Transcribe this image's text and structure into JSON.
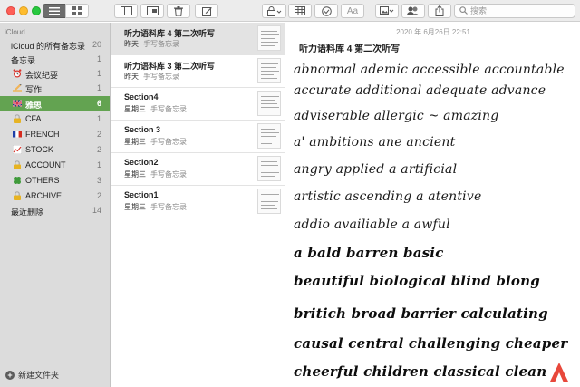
{
  "toolbar": {
    "search_placeholder": "搜索",
    "font_button_label": "Aa"
  },
  "sidebar": {
    "account": "iCloud",
    "items": [
      {
        "label": "iCloud 的所有备忘录",
        "count": "20",
        "icon": "none"
      },
      {
        "label": "备忘录",
        "count": "1",
        "icon": "none"
      },
      {
        "label": "会议纪要",
        "count": "1",
        "icon": "alarm-clock-icon"
      },
      {
        "label": "写作",
        "count": "1",
        "icon": "writing-hand-icon"
      },
      {
        "label": "雅思",
        "count": "6",
        "icon": "uk-flag-icon"
      },
      {
        "label": "CFA",
        "count": "1",
        "icon": "lock-icon"
      },
      {
        "label": "FRENCH",
        "count": "2",
        "icon": "french-flag-icon"
      },
      {
        "label": "STOCK",
        "count": "2",
        "icon": "chart-icon"
      },
      {
        "label": "ACCOUNT",
        "count": "1",
        "icon": "lock-icon"
      },
      {
        "label": "OTHERS",
        "count": "3",
        "icon": "clover-icon"
      },
      {
        "label": "ARCHIVE",
        "count": "2",
        "icon": "lock-icon"
      },
      {
        "label": "最近删除",
        "count": "14",
        "icon": "none"
      }
    ],
    "new_folder": "新建文件夹"
  },
  "notes": [
    {
      "title": "听力语料库 4 第二次听写",
      "date": "昨天",
      "folder": "手写备忘录"
    },
    {
      "title": "听力语料库 3 第二次听写",
      "date": "昨天",
      "folder": "手写备忘录"
    },
    {
      "title": "Section4",
      "date": "星期三",
      "folder": "手写备忘录"
    },
    {
      "title": "Section 3",
      "date": "星期三",
      "folder": "手写备忘录"
    },
    {
      "title": "Section2",
      "date": "星期三",
      "folder": "手写备忘录"
    },
    {
      "title": "Section1",
      "date": "星期三",
      "folder": "手写备忘录"
    }
  ],
  "editor": {
    "date": "2020 年 6月26日 22:51",
    "title": "听力语料库 4 第二次听写",
    "lines": [
      "abnormal   ademic   accessible  accountable",
      "accurate  additional  adequate  advance",
      "adviserable  allergic   ~   amazing",
      "a'       ambitions   ane   ancient",
      "angry   applied  a   artificial",
      "artistic  ascending  a    atentive",
      "addio  availiable  a   awful",
      "a    bald     barren     basic",
      "beautiful   biological  blind  blong",
      "britich   broad   barrier  calculating",
      "causal   central  challenging  cheaper",
      "cheerful  children  classical  clean"
    ]
  },
  "colors": {
    "selected_folder": "#63a351",
    "sidebar_bg": "#dcdcdc",
    "toolbar_bg": "#ececec",
    "brand_logo": "#e8483b"
  }
}
